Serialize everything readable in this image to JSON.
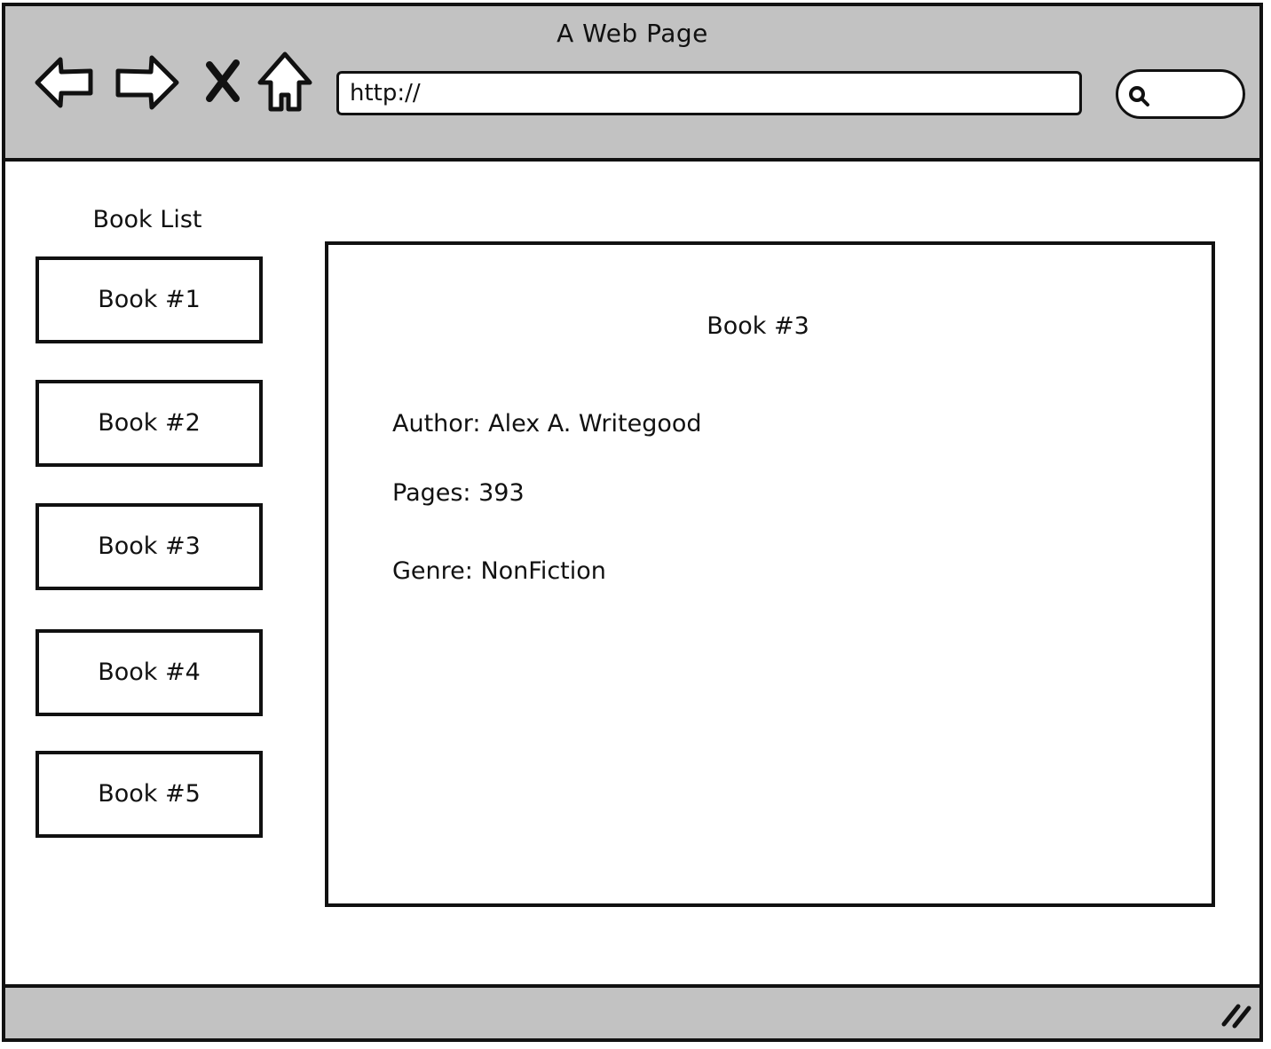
{
  "window": {
    "title": "A Web Page"
  },
  "toolbar": {
    "icons": [
      "back-arrow-icon",
      "forward-arrow-icon",
      "stop-icon",
      "home-icon"
    ],
    "url_value": "http://",
    "search_value": ""
  },
  "sidebar": {
    "title": "Book List",
    "items": [
      {
        "label": "Book #1"
      },
      {
        "label": "Book #2"
      },
      {
        "label": "Book #3"
      },
      {
        "label": "Book #4"
      },
      {
        "label": "Book #5"
      }
    ]
  },
  "detail": {
    "title": "Book #3",
    "author": "Author: Alex A. Writegood",
    "pages": "Pages: 393",
    "genre": "Genre: NonFiction"
  },
  "colors": {
    "chrome": "#c2c2c2",
    "stroke": "#111111",
    "background": "#ffffff"
  }
}
